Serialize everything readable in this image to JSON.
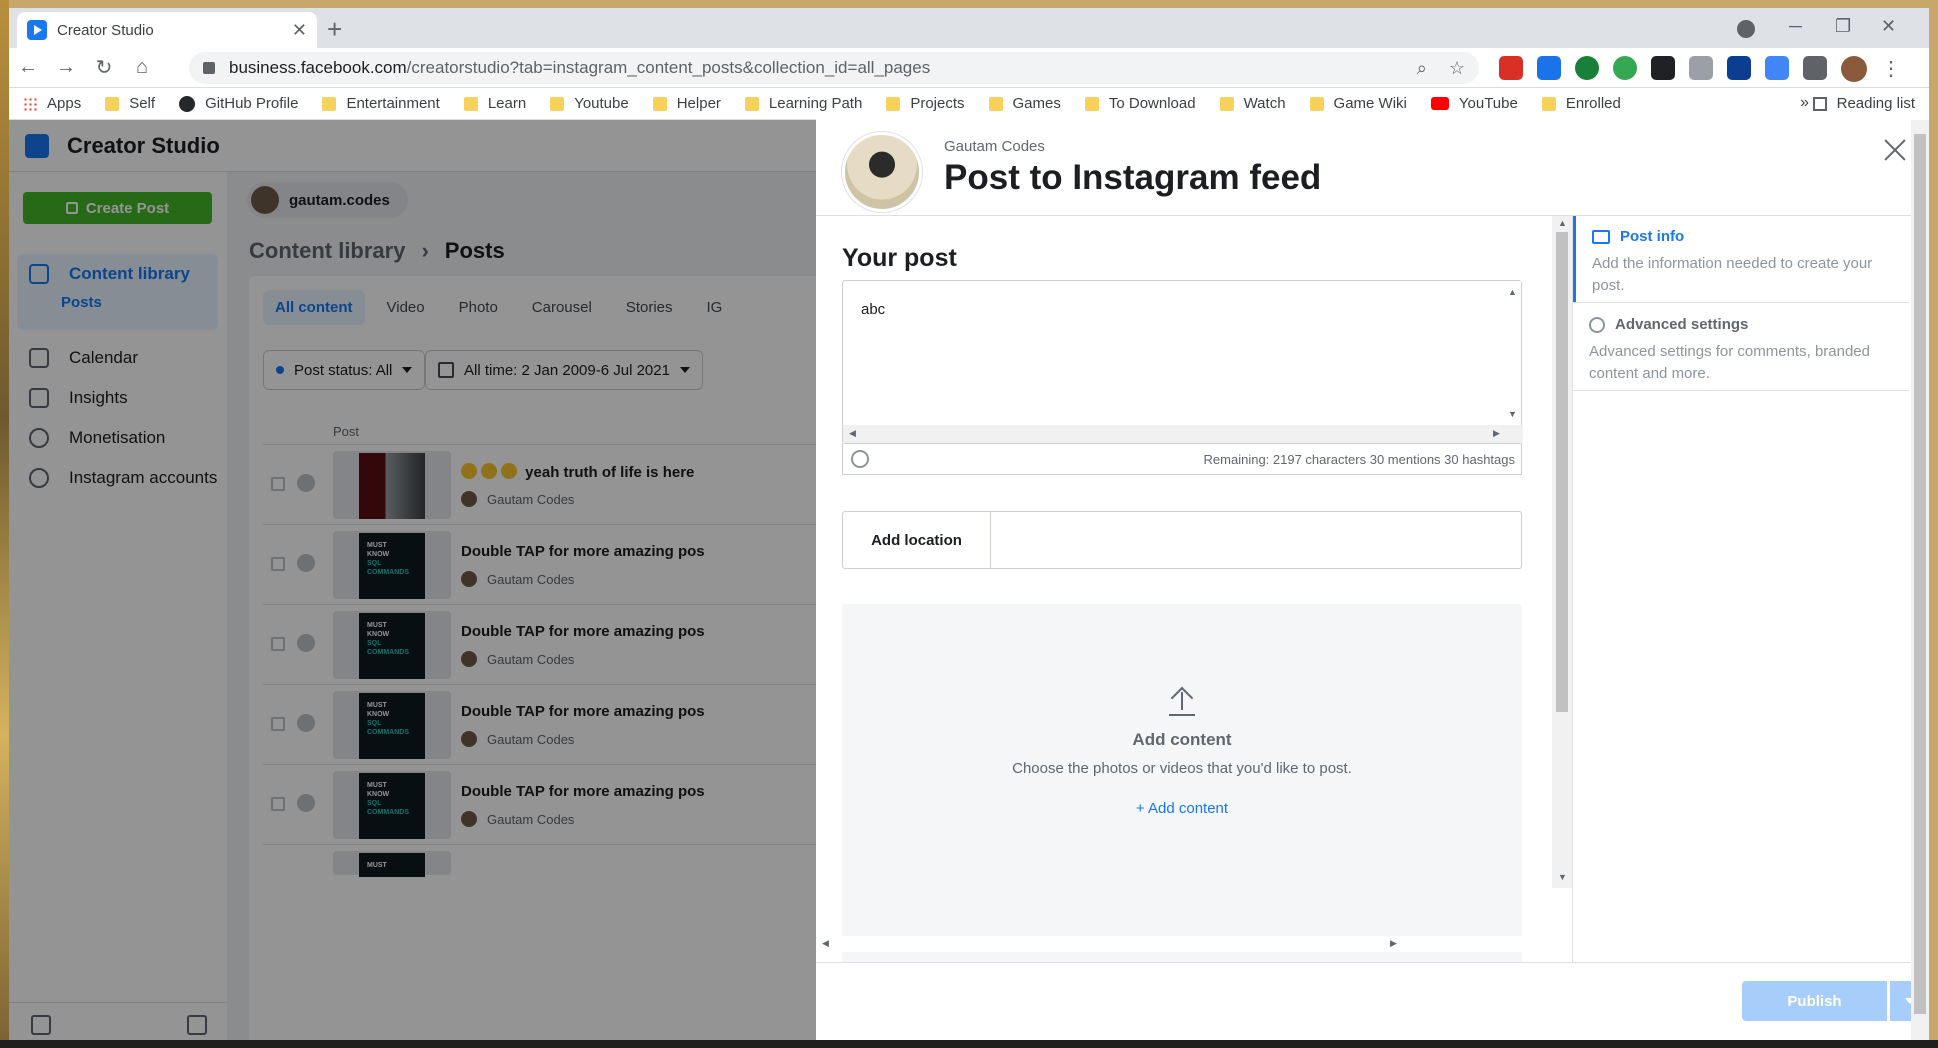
{
  "browser": {
    "tab_title": "Creator Studio",
    "tab_close": "✕",
    "new_tab": "+",
    "url_host": "business.facebook.com",
    "url_rest": "/creatorstudio?tab=instagram_content_posts&collection_id=all_pages",
    "bookmarks": [
      "Apps",
      "Self",
      "GitHub Profile",
      "Entertainment",
      "Learn",
      "Youtube",
      "Helper",
      "Learning Path",
      "Projects",
      "Games",
      "To Download",
      "Watch",
      "Game Wiki",
      "YouTube",
      "Enrolled"
    ],
    "more_bookmarks": "»",
    "reading_list": "Reading list"
  },
  "app": {
    "title": "Creator Studio",
    "create_post": "Create Post",
    "nav": {
      "content_library": "Content library",
      "posts": "Posts",
      "calendar": "Calendar",
      "insights": "Insights",
      "monetisation": "Monetisation",
      "instagram_accounts": "Instagram accounts"
    },
    "account": "gautam.codes",
    "breadcrumb_root": "Content library",
    "breadcrumb_sep": "›",
    "breadcrumb_current": "Posts",
    "filter_tabs": [
      "All content",
      "Video",
      "Photo",
      "Carousel",
      "Stories",
      "IG"
    ],
    "post_status": "Post status: All",
    "date_range": "All time: 2 Jan 2009-6 Jul 2021",
    "col_post": "Post",
    "rows": [
      {
        "title": "yeah truth of life is here",
        "author": "Gautam Codes"
      },
      {
        "title": "Double TAP for more amazing pos",
        "author": "Gautam Codes"
      },
      {
        "title": "Double TAP for more amazing pos",
        "author": "Gautam Codes"
      },
      {
        "title": "Double TAP for more amazing pos",
        "author": "Gautam Codes"
      },
      {
        "title": "Double TAP for more amazing pos",
        "author": "Gautam Codes"
      }
    ],
    "thumb_text": [
      "MUST",
      "KNOW",
      "SQL",
      "COMMANDS"
    ]
  },
  "modal": {
    "account_name": "Gautam Codes",
    "title": "Post to Instagram feed",
    "your_post": "Your post",
    "caption": "abc",
    "remaining": "Remaining: 2197 characters 30 mentions 30 hashtags",
    "add_location": "Add location",
    "add_content_title": "Add content",
    "add_content_desc": "Choose the photos or videos that you'd like to post.",
    "add_content_link": "+ Add content",
    "steps": [
      {
        "title": "Post info",
        "desc": "Add the information needed to create your post."
      },
      {
        "title": "Advanced settings",
        "desc": "Advanced settings for comments, branded content and more."
      }
    ],
    "publish": "Publish"
  }
}
